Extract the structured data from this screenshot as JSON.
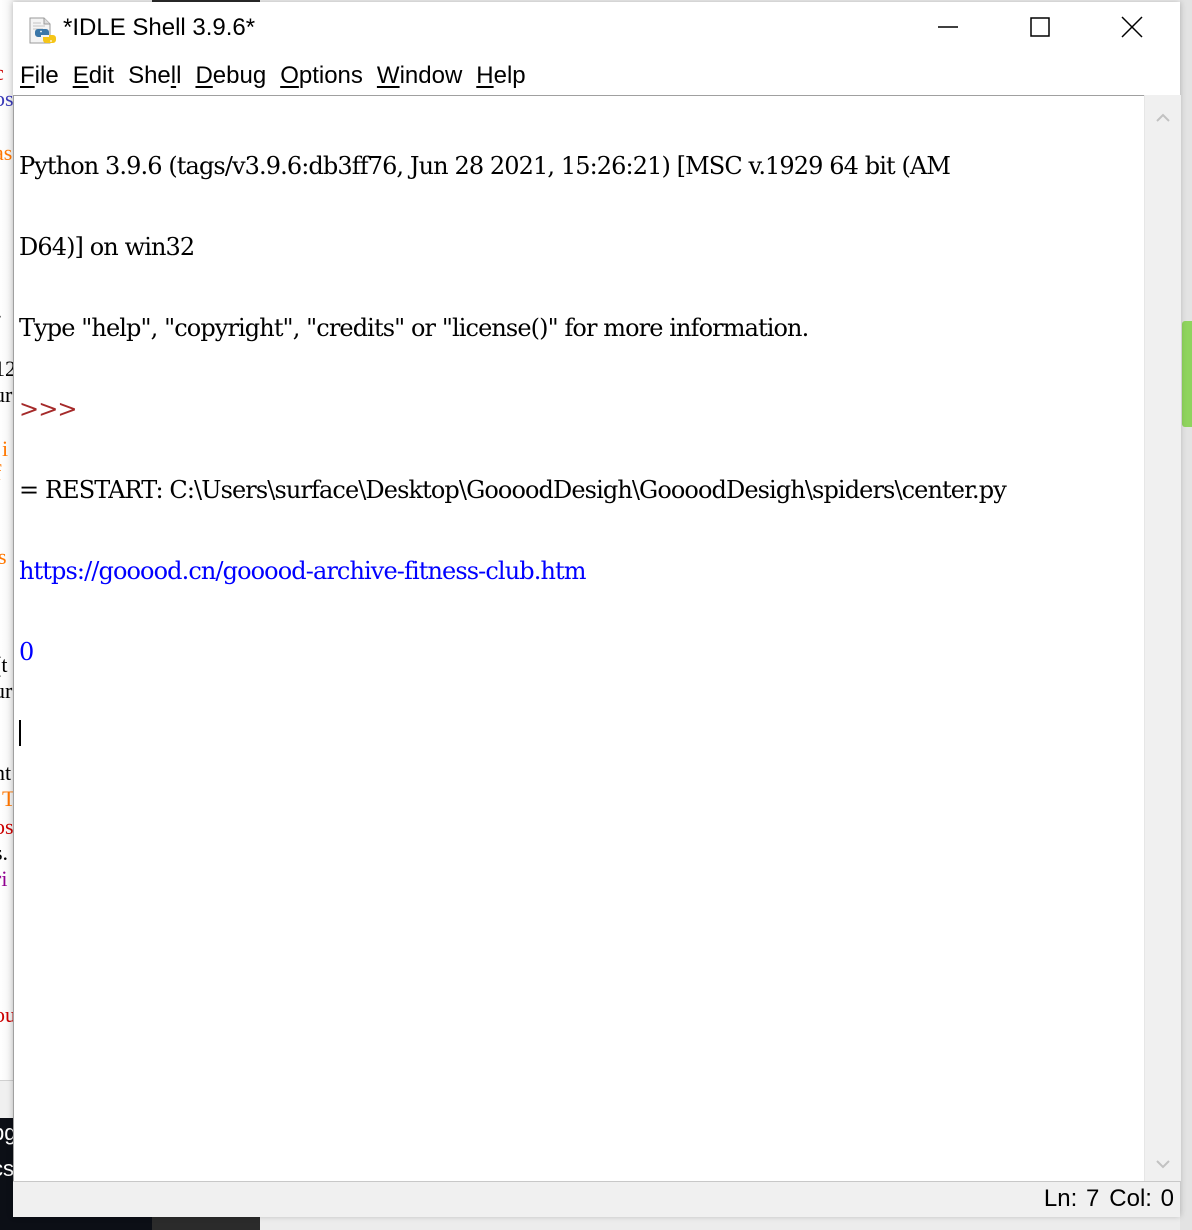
{
  "window": {
    "title": "*IDLE Shell 3.9.6*",
    "icon": "python-file-icon",
    "controls": {
      "minimize": "minimize-icon",
      "maximize": "maximize-icon",
      "close": "close-icon"
    }
  },
  "menubar": {
    "items": [
      {
        "label_u": "F",
        "label_rest": "ile"
      },
      {
        "label_u": "E",
        "label_rest": "dit"
      },
      {
        "label_pre": "She",
        "label_u": "l",
        "label_rest": "l"
      },
      {
        "label_u": "D",
        "label_rest": "ebug"
      },
      {
        "label_u": "O",
        "label_rest": "ptions"
      },
      {
        "label_u": "W",
        "label_rest": "indow"
      },
      {
        "label_u": "H",
        "label_rest": "elp"
      }
    ]
  },
  "shell": {
    "lines": [
      {
        "text": "Python 3.9.6 (tags/v3.9.6:db3ff76, Jun 28 2021, 15:26:21) [MSC v.1929 64 bit (AM",
        "kind": "default"
      },
      {
        "text": "D64)] on win32",
        "kind": "default"
      },
      {
        "text": "Type \"help\", \"copyright\", \"credits\" or \"license()\" for more information.",
        "kind": "default"
      },
      {
        "text": ">>> ",
        "kind": "prompt"
      },
      {
        "text": "= RESTART: C:\\Users\\surface\\Desktop\\GoooodDesigh\\GoooodDesigh\\spiders\\center.py",
        "kind": "default"
      },
      {
        "text": "https://gooood.cn/gooood-archive-fitness-club.htm",
        "kind": "stdout"
      },
      {
        "text": "0",
        "kind": "stdout"
      }
    ]
  },
  "status": {
    "line": "Ln: 7",
    "col": "Col: 0"
  },
  "colors": {
    "prompt": "#a52a2a",
    "stdout": "#0000ff",
    "default": "#000000",
    "background_accent": "#8fd45e"
  },
  "background_editor_fragments": [
    {
      "text": "c",
      "color": "#cc0000"
    },
    {
      "text": "os",
      "color": "#3a3ab8"
    },
    {
      "text": "as",
      "color": "#ff7700"
    },
    {
      "text": "-",
      "color": "#000000"
    },
    {
      "text": "12",
      "color": "#000000"
    },
    {
      "text": "ur",
      "color": "#000000"
    },
    {
      "text": "i",
      "color": "#ff7700"
    },
    {
      "text": "f",
      "color": "#ff7700"
    },
    {
      "text": "s",
      "color": "#ff7700"
    },
    {
      "text": "(t",
      "color": "#000000"
    },
    {
      "text": "ur",
      "color": "#000000"
    },
    {
      "text": "nt",
      "color": "#000000"
    },
    {
      "text": "T",
      "color": "#ff7700"
    },
    {
      "text": "os",
      "color": "#cc0000"
    },
    {
      "text": "s.",
      "color": "#000000"
    },
    {
      "text": "ri",
      "color": "#900090"
    },
    {
      "text": "ou",
      "color": "#cc0000"
    }
  ],
  "background_taskbar_fragments": [
    "pg",
    "cs"
  ]
}
